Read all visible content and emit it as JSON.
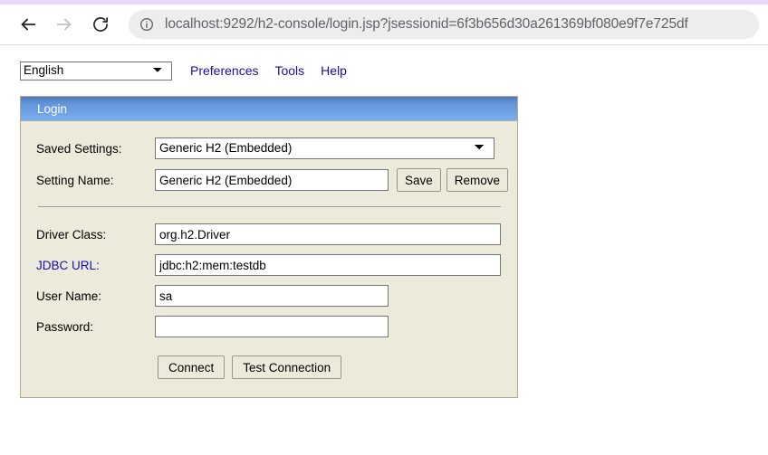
{
  "browser": {
    "back_icon": "arrow-left-icon",
    "forward_icon": "arrow-right-icon",
    "reload_icon": "reload-icon",
    "site_info_icon": "info-circle-icon",
    "url": "localhost:9292/h2-console/login.jsp?jsessionid=6f3b656d30a261369bf080e9f7e725df",
    "tab_strip_color": "#ead9fb"
  },
  "page": {
    "toolbar": {
      "language_selected": "English",
      "language_options": [
        "English"
      ],
      "links": [
        {
          "label": "Preferences"
        },
        {
          "label": "Tools"
        },
        {
          "label": "Help"
        }
      ]
    },
    "panel": {
      "title": "Login",
      "header_color": "#6394d8",
      "background_color": "#eceadb",
      "border_color": "#b2ab93",
      "link_color": "#1a0dab",
      "fields": {
        "saved_settings": {
          "label": "Saved Settings:",
          "value": "Generic H2 (Embedded)",
          "options": [
            "Generic H2 (Embedded)"
          ]
        },
        "setting_name": {
          "label": "Setting Name:",
          "value": "Generic H2 (Embedded)",
          "placeholder": ""
        },
        "driver_class": {
          "label": "Driver Class:",
          "value": "org.h2.Driver",
          "placeholder": ""
        },
        "jdbc_url": {
          "label": "JDBC URL:",
          "value": "jdbc:h2:mem:testdb",
          "placeholder": ""
        },
        "user_name": {
          "label": "User Name:",
          "value": "sa",
          "placeholder": ""
        },
        "password": {
          "label": "Password:",
          "value": "",
          "placeholder": ""
        }
      },
      "buttons": {
        "save": "Save",
        "remove": "Remove",
        "connect": "Connect",
        "test_connection": "Test Connection"
      }
    }
  }
}
